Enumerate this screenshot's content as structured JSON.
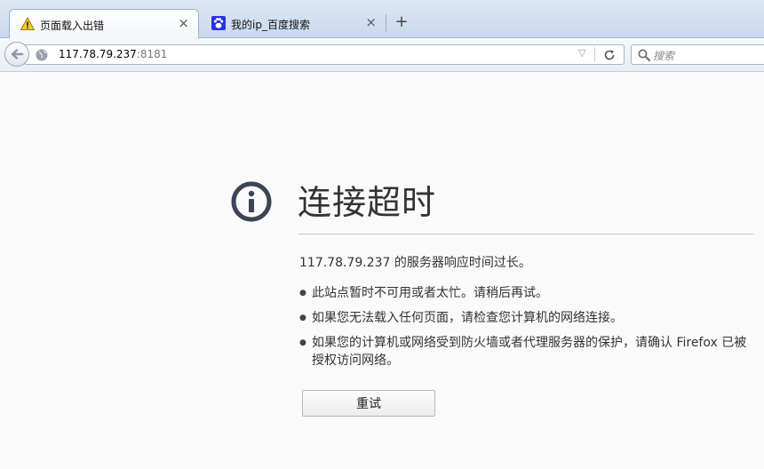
{
  "tabs": [
    {
      "title": "页面载入出错",
      "icon": "warning-icon",
      "close": "×",
      "active": true
    },
    {
      "title": "我的ip_百度搜索",
      "icon": "baidu-paw-icon",
      "close": "×",
      "active": false
    }
  ],
  "new_tab_label": "+",
  "navbar": {
    "url_host": "117.78.79.237",
    "url_port": ":8181",
    "search_placeholder": "搜索"
  },
  "error": {
    "title": "连接超时",
    "short_desc": "117.78.79.237 的服务器响应时间过长。",
    "tips": [
      "此站点暂时不可用或者太忙。请稍后再试。",
      "如果您无法载入任何页面，请检查您计算机的网络连接。",
      "如果您的计算机或网络受到防火墙或者代理服务器的保护，请确认 Firefox 已被授权访问网络。"
    ],
    "retry_label": "重试"
  },
  "colors": {
    "accent": "#3c4557",
    "tab_strip": "#c9d9ee",
    "baidu_blue": "#2932e1",
    "warning_yellow": "#f4c82c"
  }
}
